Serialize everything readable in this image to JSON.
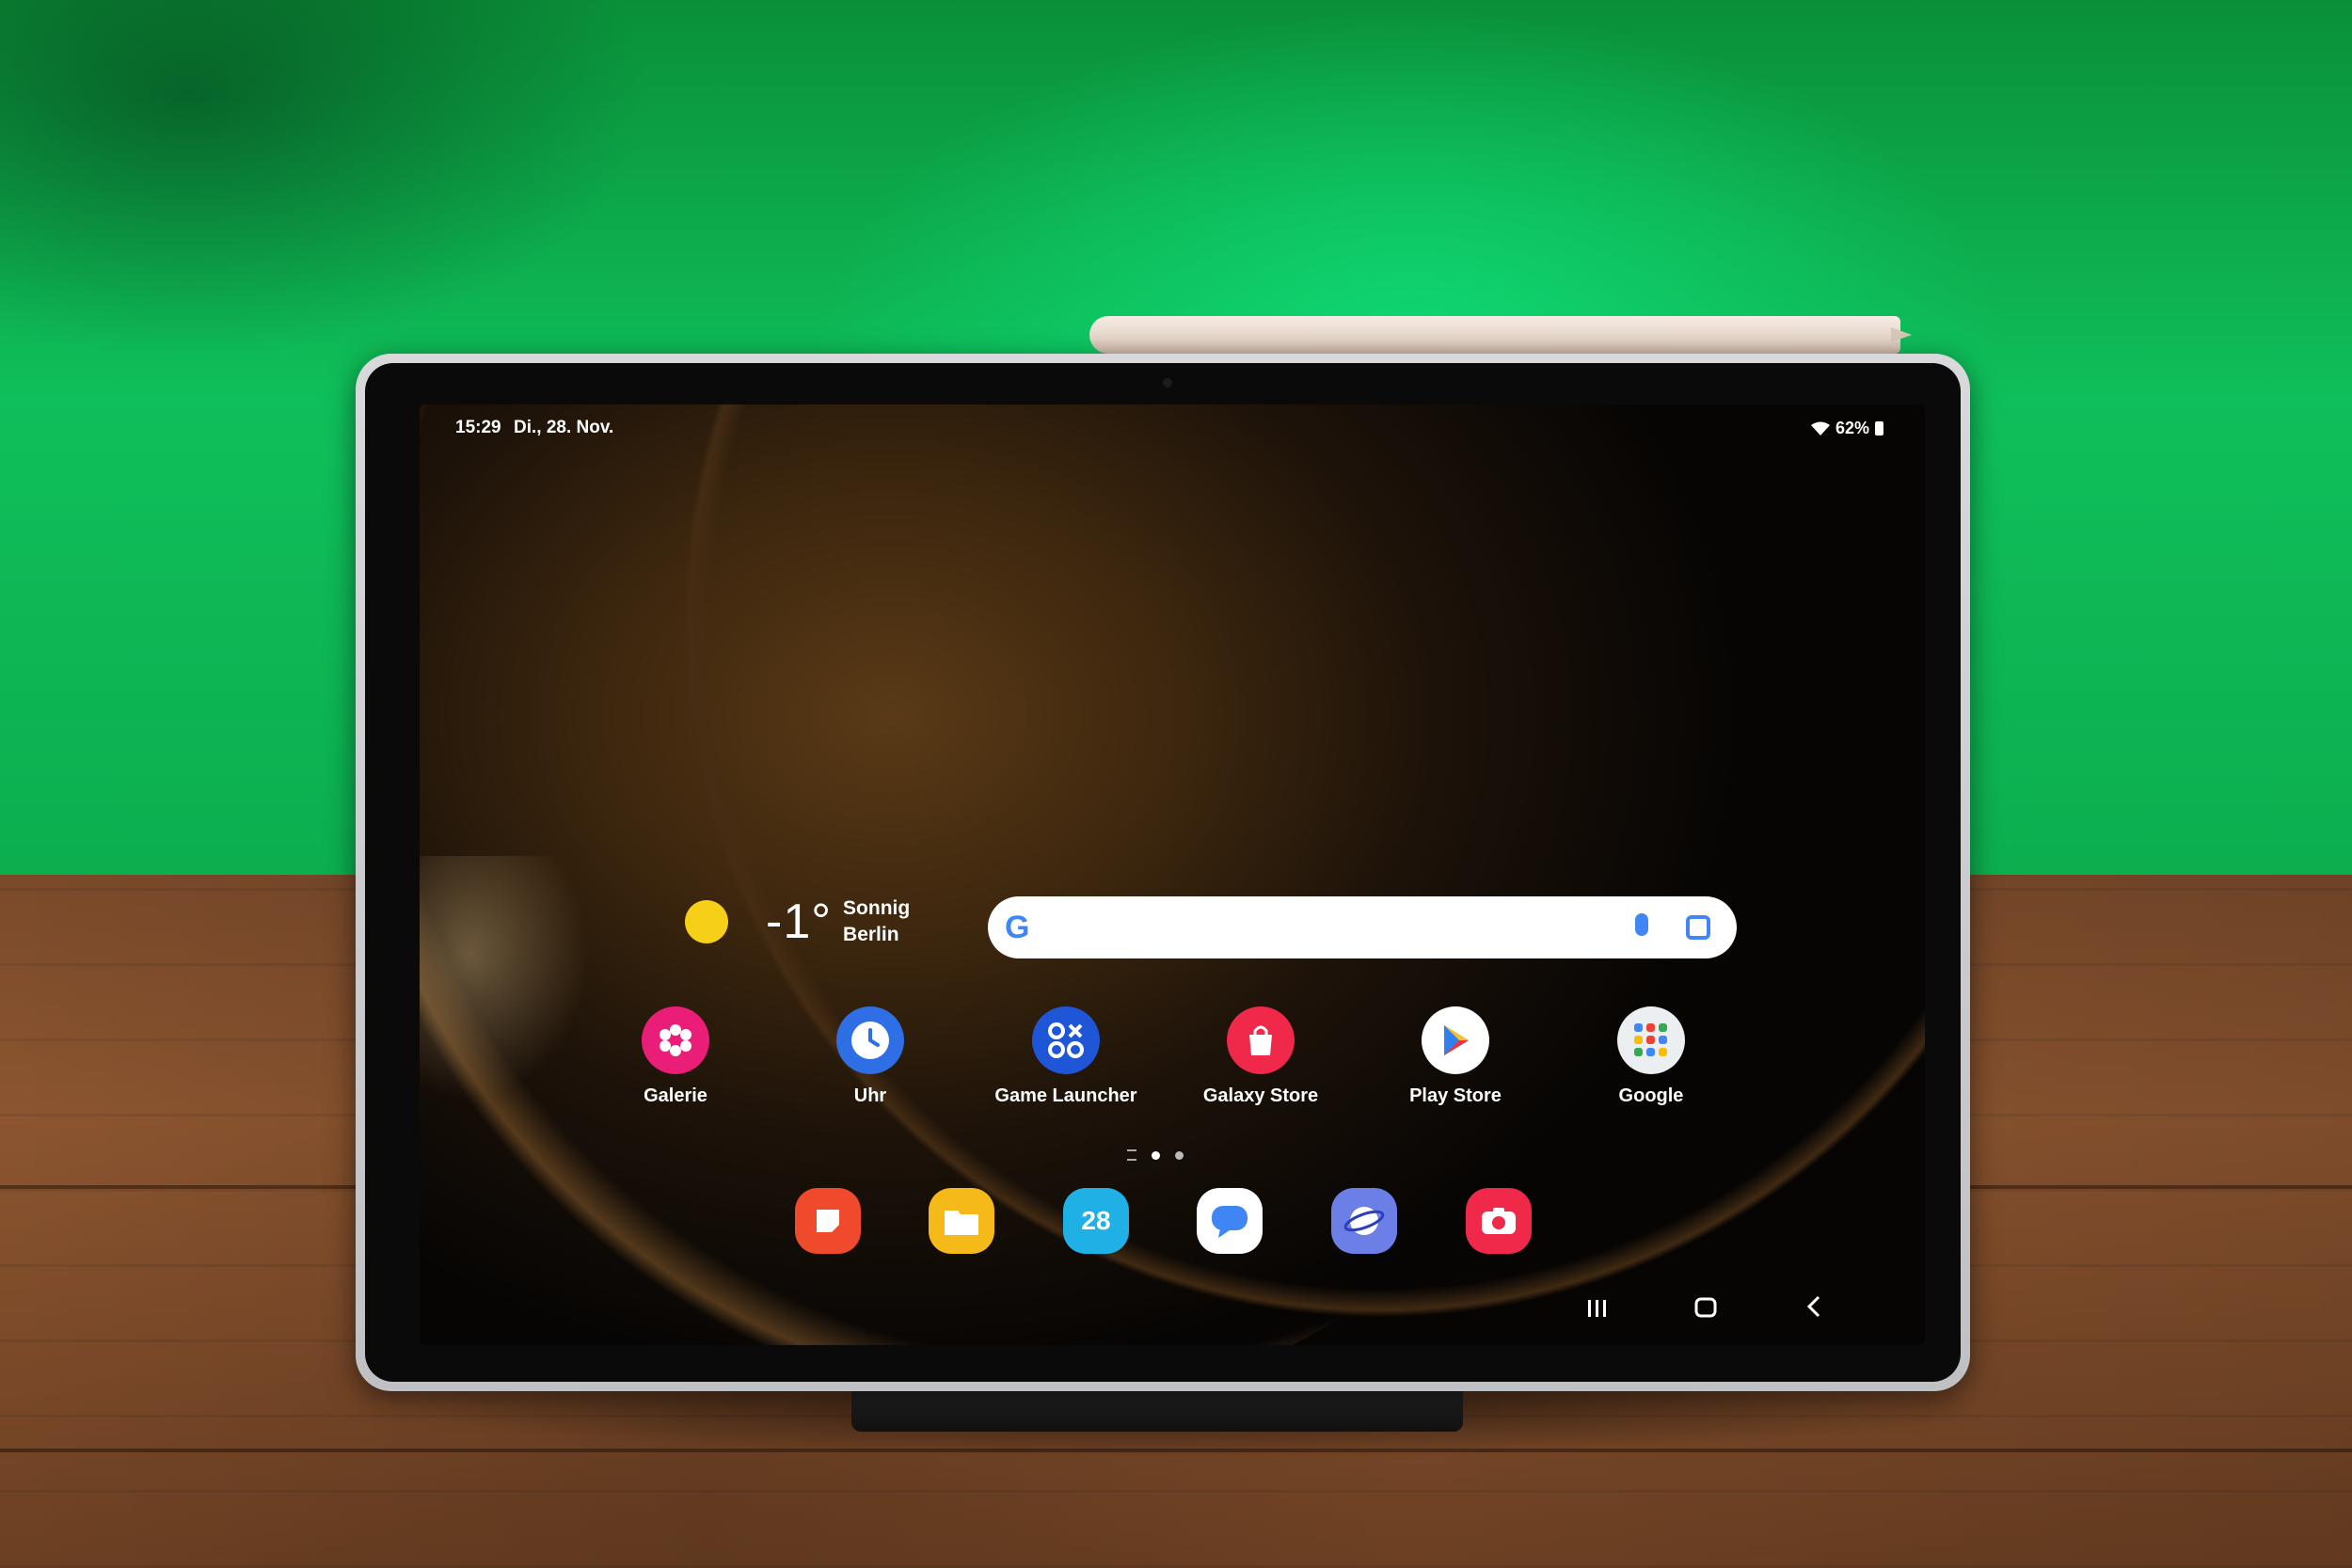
{
  "status_bar": {
    "time": "15:29",
    "date": "Di., 28. Nov.",
    "battery": "62%"
  },
  "weather": {
    "temperature": "-1°",
    "condition": "Sonnig",
    "city": "Berlin"
  },
  "search": {
    "logo": "G"
  },
  "apps": [
    {
      "label": "Galerie",
      "icon": "flower-icon",
      "color": "#ea1e79"
    },
    {
      "label": "Uhr",
      "icon": "clock-icon",
      "color": "#2f6fe6"
    },
    {
      "label": "Game Launcher",
      "icon": "game-launcher-icon",
      "color": "#1f56d8"
    },
    {
      "label": "Galaxy Store",
      "icon": "shopping-bag-icon",
      "color": "#f0284a"
    },
    {
      "label": "Play Store",
      "icon": "play-triangle-icon",
      "color": "#ffffff"
    },
    {
      "label": "Google",
      "icon": "google-folder-icon",
      "color": "#ffffff"
    }
  ],
  "dock": [
    {
      "icon": "notes-icon",
      "color": "#f04a2c",
      "text": ""
    },
    {
      "icon": "folder-icon",
      "color": "#f6b91a",
      "text": ""
    },
    {
      "icon": "calendar-icon",
      "color": "#1fb1e6",
      "text": "28"
    },
    {
      "icon": "messages-icon",
      "color": "#ffffff",
      "text": ""
    },
    {
      "icon": "internet-icon",
      "color": "#6c7fe6",
      "text": ""
    },
    {
      "icon": "camera-icon",
      "color": "#f0284a",
      "text": ""
    }
  ],
  "pager": {
    "pages": 2,
    "active": 1
  },
  "colors": {
    "wall": "#0fbf5a",
    "table": "#8c5530",
    "tablet_frame": "#cfd0d3",
    "wallpaper": "#3c260e"
  }
}
